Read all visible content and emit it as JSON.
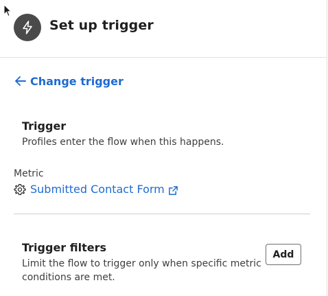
{
  "header": {
    "icon": "lightning-bolt-icon",
    "title": "Set up trigger"
  },
  "back_link": {
    "icon": "arrow-left-icon",
    "label": "Change trigger"
  },
  "trigger_section": {
    "title": "Trigger",
    "description": "Profiles enter the flow when this happens."
  },
  "metric": {
    "label": "Metric",
    "icon": "gear-icon",
    "value": "Submitted Contact Form",
    "link_icon": "external-link-icon"
  },
  "filters_section": {
    "title": "Trigger filters",
    "description_line1": "Limit the flow to trigger only when specific metric",
    "description_line2": "conditions are met.",
    "add_button_label": "Add"
  },
  "colors": {
    "link": "#1f6bd1",
    "icon_circle": "#4a4a4a",
    "divider": "#cfcfcf"
  }
}
